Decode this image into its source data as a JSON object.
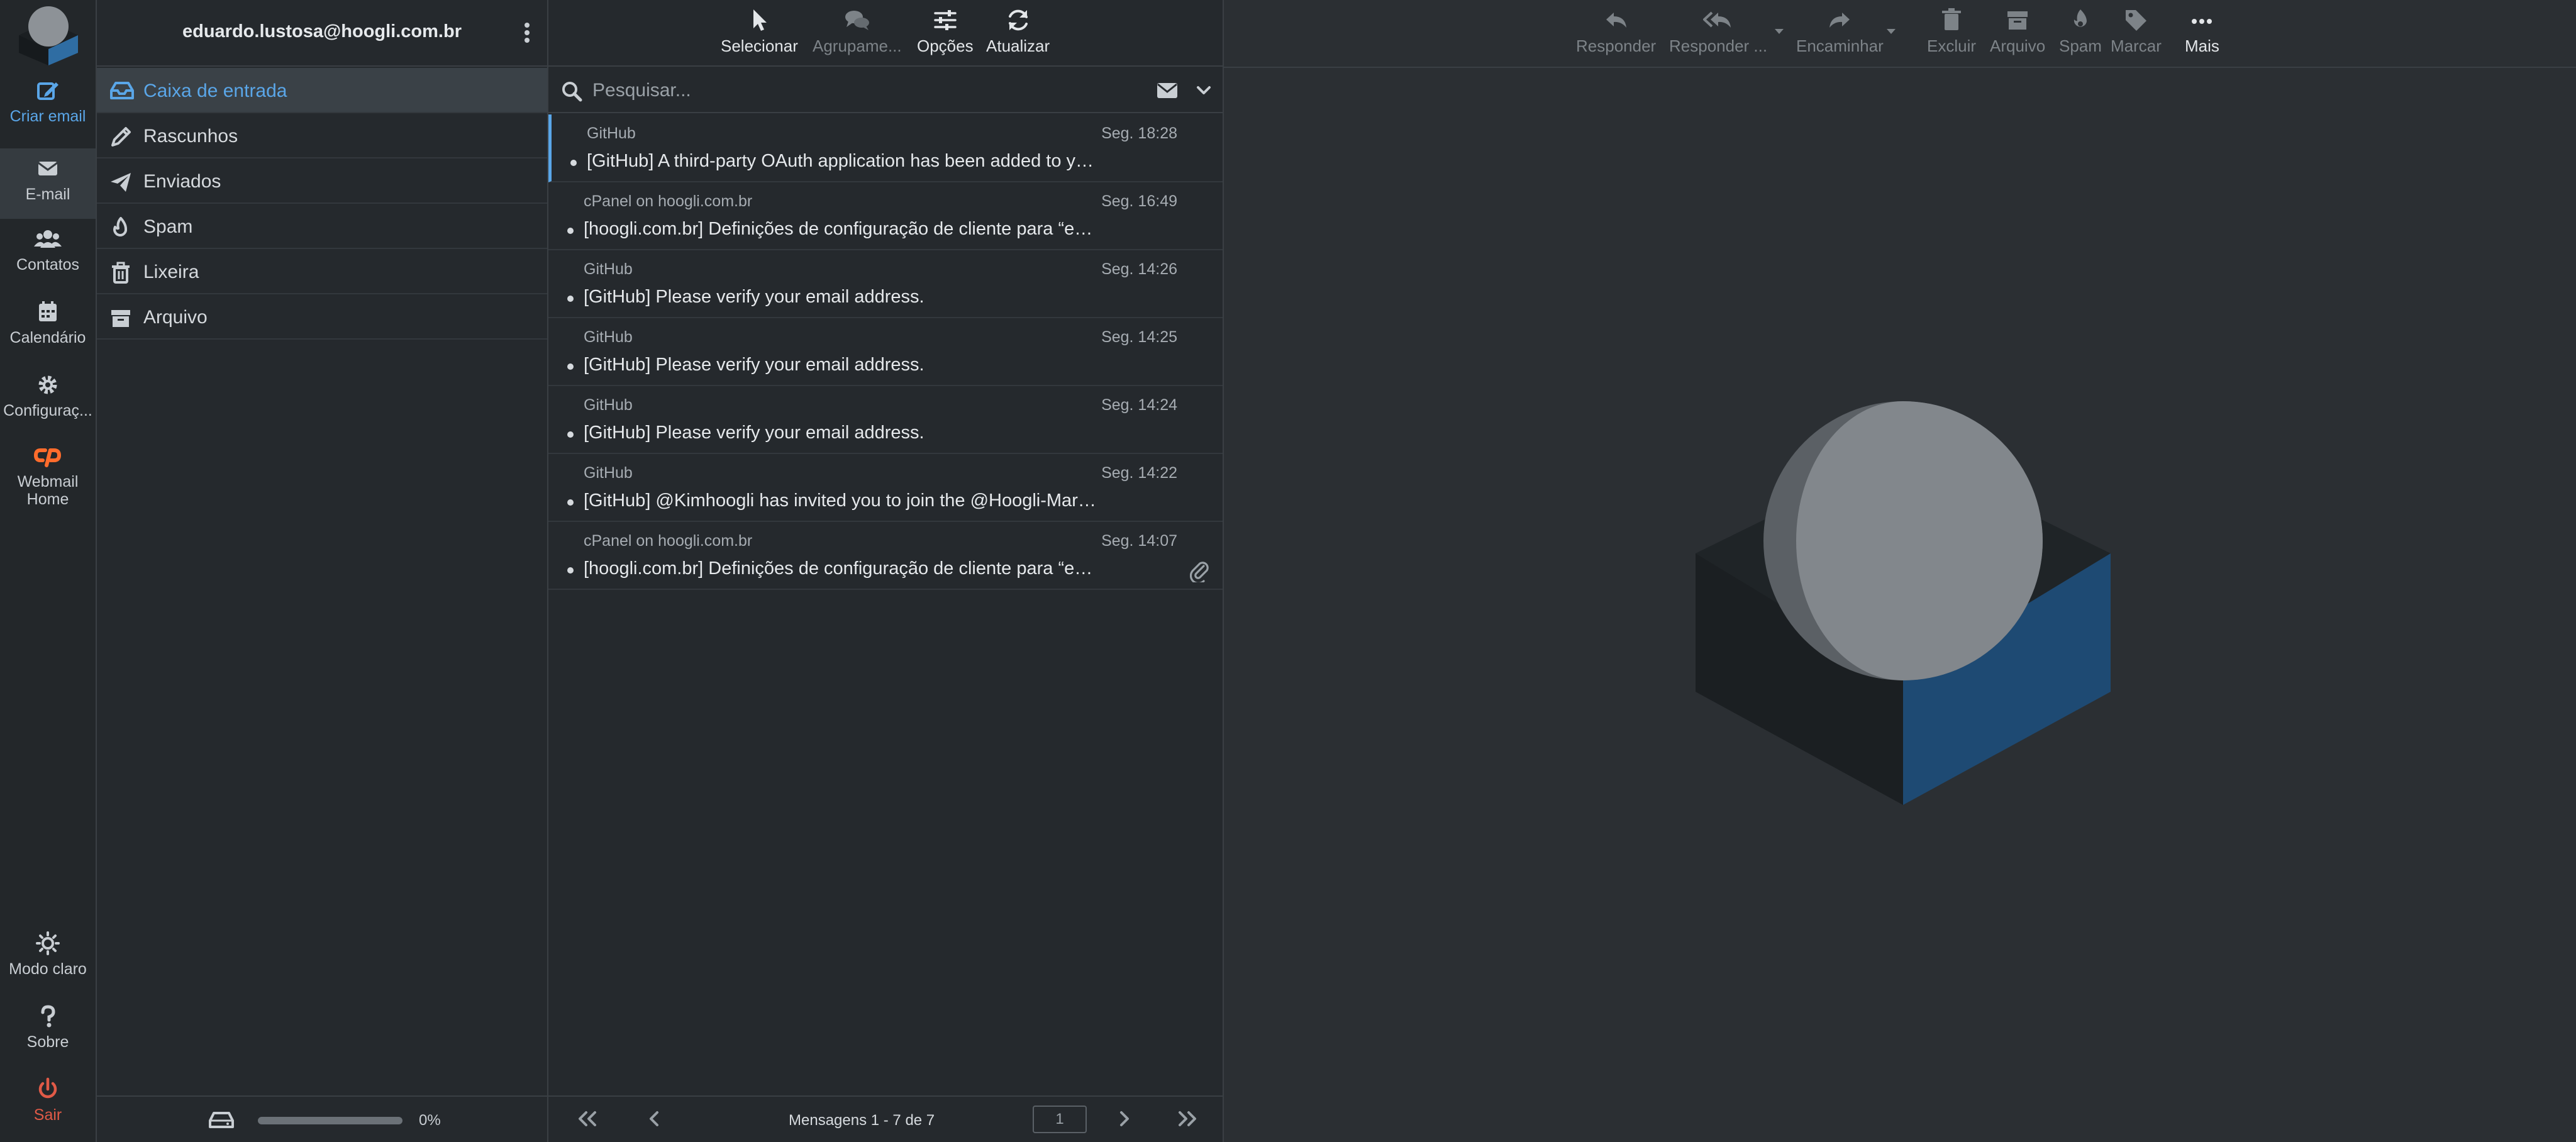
{
  "account": {
    "email": "eduardo.lustosa@hoogli.com.br"
  },
  "rail": {
    "compose": "Criar email",
    "mail": "E-mail",
    "contacts": "Contatos",
    "calendar": "Calendário",
    "settings": "Configuraç...",
    "webmail_home": "Webmail Home",
    "light_mode": "Modo claro",
    "about": "Sobre",
    "logout": "Sair"
  },
  "folders": [
    {
      "name": "Caixa de entrada",
      "icon": "inbox-icon",
      "selected": true
    },
    {
      "name": "Rascunhos",
      "icon": "pencil-icon"
    },
    {
      "name": "Enviados",
      "icon": "paper-plane-icon"
    },
    {
      "name": "Spam",
      "icon": "fire-icon"
    },
    {
      "name": "Lixeira",
      "icon": "trash-icon"
    },
    {
      "name": "Arquivo",
      "icon": "archive-icon"
    }
  ],
  "quota": {
    "label": "0%",
    "value": 0
  },
  "list_toolbar": {
    "select": "Selecionar",
    "group": "Agrupame...",
    "options": "Opções",
    "refresh": "Atualizar"
  },
  "search": {
    "placeholder": "Pesquisar..."
  },
  "messages": [
    {
      "from": "GitHub",
      "date": "Seg. 18:28",
      "subject": "[GitHub] A third-party OAuth application has been added to your account"
    },
    {
      "from": "cPanel on hoogli.com.br",
      "date": "Seg. 16:49",
      "subject": "[hoogli.com.br] Definições de configuração de cliente para “eduardo.lustosa@hoogli.com.br”"
    },
    {
      "from": "GitHub",
      "date": "Seg. 14:26",
      "subject": "[GitHub] Please verify your email address."
    },
    {
      "from": "GitHub",
      "date": "Seg. 14:25",
      "subject": "[GitHub] Please verify your email address."
    },
    {
      "from": "GitHub",
      "date": "Seg. 14:24",
      "subject": "[GitHub] Please verify your email address."
    },
    {
      "from": "GitHub",
      "date": "Seg. 14:22",
      "subject": "[GitHub] @Kimhoogli has invited you to join the @Hoogli-Marketing organization"
    },
    {
      "from": "cPanel on hoogli.com.br",
      "date": "Seg. 14:07",
      "subject": "[hoogli.com.br] Definições de configuração de cliente para “eduardo.lustosa@hoogli.com.br”",
      "attachment": true
    }
  ],
  "pager": {
    "count": "Mensagens 1 - 7 de 7",
    "page": "1"
  },
  "preview_toolbar": {
    "reply": "Responder",
    "reply_all": "Responder ...",
    "forward": "Encaminhar",
    "delete": "Excluir",
    "archive": "Arquivo",
    "spam": "Spam",
    "mark": "Marcar",
    "more": "Mais"
  },
  "colors": {
    "accent": "#5aa6e8",
    "danger": "#e05a47",
    "cpanel": "#ff6c2c",
    "background": "#2b2f33"
  }
}
